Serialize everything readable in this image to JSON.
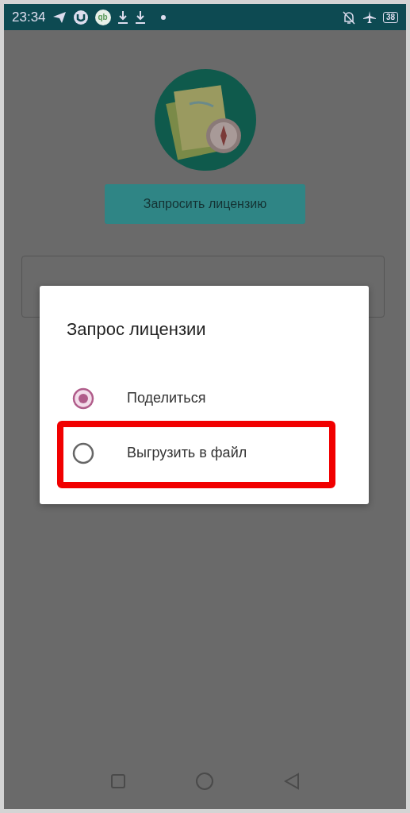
{
  "status_bar": {
    "time": "23:34",
    "app_badge": "qb",
    "battery": "38"
  },
  "request_button": {
    "label": "Запросить лицензию"
  },
  "dialog": {
    "title": "Запрос лицензии",
    "options": [
      {
        "label": "Поделиться",
        "selected": true,
        "highlighted": false
      },
      {
        "label": "Выгрузить в файл",
        "selected": false,
        "highlighted": true
      }
    ]
  }
}
